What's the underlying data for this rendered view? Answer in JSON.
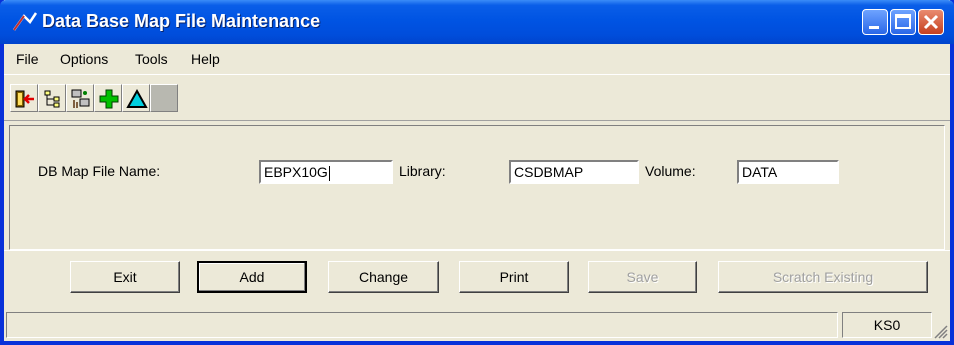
{
  "window": {
    "title": "Data Base Map File Maintenance"
  },
  "menu": [
    "File",
    "Options",
    "Tools",
    "Help"
  ],
  "toolbar": {
    "icons": [
      "exit-door-icon",
      "tree-icon",
      "network-icon",
      "add-plus-icon",
      "change-triangle-icon",
      "blank-icon"
    ],
    "accent": "#00a000"
  },
  "form": {
    "map_file_label": "DB Map File Name:",
    "map_file_value": "EBPX10G",
    "library_label": "Library:",
    "library_value": "CSDBMAP",
    "volume_label": "Volume:",
    "volume_value": "DATA"
  },
  "buttons": {
    "exit": "Exit",
    "add": "Add",
    "change": "Change",
    "print": "Print",
    "save": "Save",
    "scratch": "Scratch Existing"
  },
  "status": {
    "code": "KS0"
  },
  "colors": {
    "titlebar": "#0054e3",
    "face": "#ece9d8",
    "disabled_text": "#a0a0a0"
  }
}
